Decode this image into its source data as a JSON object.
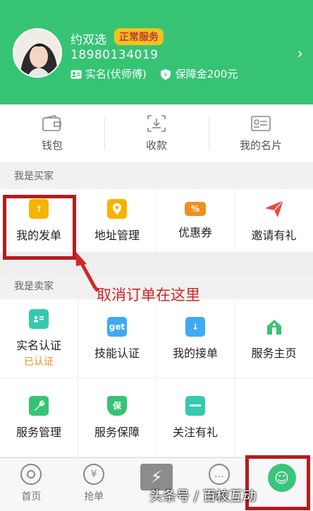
{
  "profile": {
    "name": "约双选",
    "status_badge": "正常服务",
    "phone": "18980134019",
    "verified_label": "实名(伏师傅)",
    "deposit_label": "保障金200元"
  },
  "wallet_row": [
    {
      "label": "钱包",
      "icon": "wallet-icon"
    },
    {
      "label": "收款",
      "icon": "receive-payment-icon"
    },
    {
      "label": "我的名片",
      "icon": "business-card-icon"
    }
  ],
  "buyer": {
    "section_title": "我是买家",
    "items": [
      {
        "label": "我的发单",
        "icon": "post-order-icon",
        "color": "#f5b400"
      },
      {
        "label": "地址管理",
        "icon": "location-pin-icon",
        "color": "#f5b400"
      },
      {
        "label": "优惠券",
        "icon": "coupon-icon",
        "color": "#f08f1e"
      },
      {
        "label": "邀请有礼",
        "icon": "paper-plane-icon",
        "color": "#e84a4a"
      }
    ]
  },
  "seller": {
    "section_title": "我是卖家",
    "items": [
      {
        "label": "实名认证",
        "sub": "已认证",
        "icon": "id-card-icon",
        "color": "#35c9b0"
      },
      {
        "label": "技能认证",
        "icon": "get-skill-icon",
        "icon_text": "get",
        "color": "#3fa9f5"
      },
      {
        "label": "我的接单",
        "icon": "download-arrow-icon",
        "color": "#3fa9f5"
      },
      {
        "label": "服务主页",
        "icon": "home-icon",
        "color": "#36c474"
      },
      {
        "label": "服务管理",
        "icon": "wrench-icon",
        "color": "#36c474"
      },
      {
        "label": "服务保障",
        "icon": "shield-icon",
        "icon_text": "保",
        "color": "#36c474"
      },
      {
        "label": "关注有礼",
        "icon": "follow-icon",
        "color": "#35c9b0"
      }
    ]
  },
  "annotation": {
    "callout_text": "取消订单在这里"
  },
  "tabbar": [
    {
      "label": "首页",
      "icon": "home-circle-icon"
    },
    {
      "label": "抢单",
      "icon": "yen-icon",
      "glyph": "¥"
    },
    {
      "label": "",
      "icon": "lightning-icon",
      "glyph": "⚡"
    },
    {
      "label": "消息",
      "icon": "message-icon",
      "glyph": "…"
    },
    {
      "label": "",
      "icon": "smiley-icon",
      "glyph": "☺"
    }
  ],
  "watermark": "头条号 / 百校互动",
  "colors": {
    "brand_green": "#36c474",
    "badge_yellow": "#f5c120",
    "highlight_red": "#b31d1d"
  }
}
